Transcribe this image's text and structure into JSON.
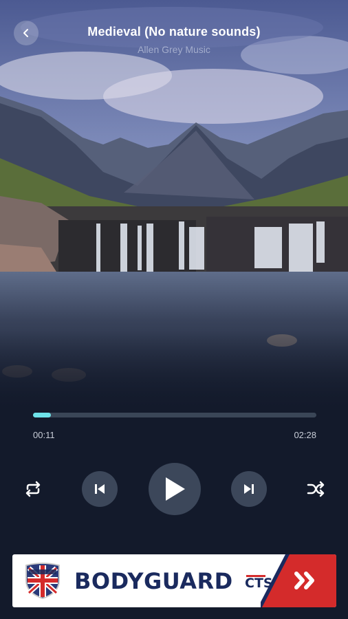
{
  "player": {
    "title": "Medieval (No nature sounds)",
    "artist": "Allen Grey Music",
    "elapsed": "00:11",
    "total": "02:28",
    "progress_percent": 6.2
  },
  "icons": {
    "back": "chevron-left-icon",
    "repeat": "repeat-icon",
    "previous": "skip-previous-icon",
    "play": "play-icon",
    "next": "skip-next-icon",
    "shuffle": "shuffle-icon",
    "ad_cta": "double-chevron-right-icon"
  },
  "ad": {
    "brand": "BODYGUARD",
    "sub": "CTS",
    "logo_text": "BODYGUARD"
  },
  "colors": {
    "background": "#131a2b",
    "accent": "#6ee3ea",
    "track": "#3a4657",
    "button_bg": "#3c475a",
    "ad_brand": "#1a2a5e",
    "ad_cta": "#d42b2b"
  }
}
